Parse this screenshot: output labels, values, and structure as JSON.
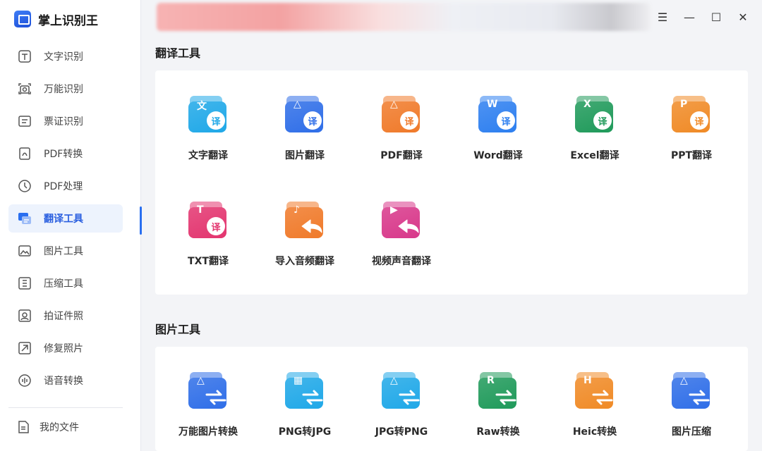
{
  "app": {
    "title": "掌上识别王"
  },
  "sidebar": {
    "items": [
      {
        "label": "文字识别"
      },
      {
        "label": "万能识别"
      },
      {
        "label": "票证识别"
      },
      {
        "label": "PDF转换"
      },
      {
        "label": "PDF处理"
      },
      {
        "label": "翻译工具"
      },
      {
        "label": "图片工具"
      },
      {
        "label": "压缩工具"
      },
      {
        "label": "拍证件照"
      },
      {
        "label": "修复照片"
      },
      {
        "label": "语音转换"
      }
    ],
    "active_index": 5,
    "my_files": "我的文件"
  },
  "window_controls": {
    "menu": "☰",
    "minimize": "—",
    "maximize": "☐",
    "close": "✕"
  },
  "sections": {
    "translate": {
      "title": "翻译工具",
      "tools": [
        {
          "label": "文字翻译",
          "glyph": "文",
          "badge": "译",
          "color": "#1fa8e8"
        },
        {
          "label": "图片翻译",
          "glyph": "△",
          "badge": "译",
          "color": "#2f6ee8"
        },
        {
          "label": "PDF翻译",
          "glyph": "△",
          "badge": "译",
          "color": "#f07a2a"
        },
        {
          "label": "Word翻译",
          "glyph": "W",
          "badge": "译",
          "color": "#2d7ff0"
        },
        {
          "label": "Excel翻译",
          "glyph": "X",
          "badge": "译",
          "color": "#1f9a5a"
        },
        {
          "label": "PPT翻译",
          "glyph": "P",
          "badge": "译",
          "color": "#f08a26"
        },
        {
          "label": "TXT翻译",
          "glyph": "T",
          "badge": "译",
          "color": "#e3356f"
        },
        {
          "label": "导入音频翻译",
          "glyph": "♪",
          "badge": "",
          "color": "#f07a2a"
        },
        {
          "label": "视频声音翻译",
          "glyph": "▶",
          "badge": "",
          "color": "#d8388a"
        }
      ]
    },
    "image": {
      "title": "图片工具",
      "tools": [
        {
          "label": "万能图片转换",
          "glyph": "△",
          "color": "#2f6ee8"
        },
        {
          "label": "PNG转JPG",
          "glyph": "▦",
          "color": "#1fa8e8"
        },
        {
          "label": "JPG转PNG",
          "glyph": "△",
          "color": "#1fa8e8"
        },
        {
          "label": "Raw转换",
          "glyph": "R",
          "color": "#1f9a5a"
        },
        {
          "label": "Heic转换",
          "glyph": "H",
          "color": "#f08a26"
        },
        {
          "label": "图片压缩",
          "glyph": "△",
          "color": "#2f6ee8"
        }
      ]
    }
  }
}
